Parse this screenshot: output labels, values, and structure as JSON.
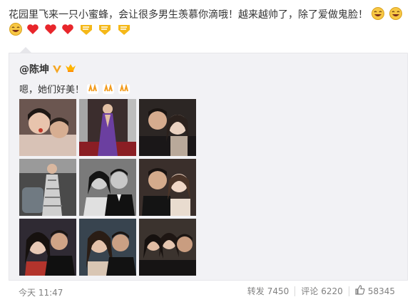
{
  "post": {
    "text_part1": "花园里飞来一只小蜜蜂，会让很多男生羡慕你滴哦！越来越帅了，除了爱做鬼脸！",
    "emojis_line1": [
      "laugh-emoji",
      "laugh-emoji"
    ],
    "emojis_line2": [
      "laugh-emoji",
      "heart-emoji",
      "heart-emoji",
      "heart-emoji",
      "ribbon-emoji",
      "ribbon-emoji",
      "ribbon-emoji"
    ]
  },
  "retweet": {
    "author": "@陈坤",
    "text": "嗯，她们好美！",
    "emojis": [
      "applause-emoji",
      "applause-emoji",
      "applause-emoji"
    ]
  },
  "footer": {
    "time": "今天 11:47",
    "repost_label": "转发",
    "repost_count": "7450",
    "comment_label": "评论",
    "comment_count": "6220",
    "like_count": "58345"
  },
  "colors": {
    "link": "#eb7350",
    "meta": "#808080",
    "retweet_bg": "#f2f2f5"
  }
}
